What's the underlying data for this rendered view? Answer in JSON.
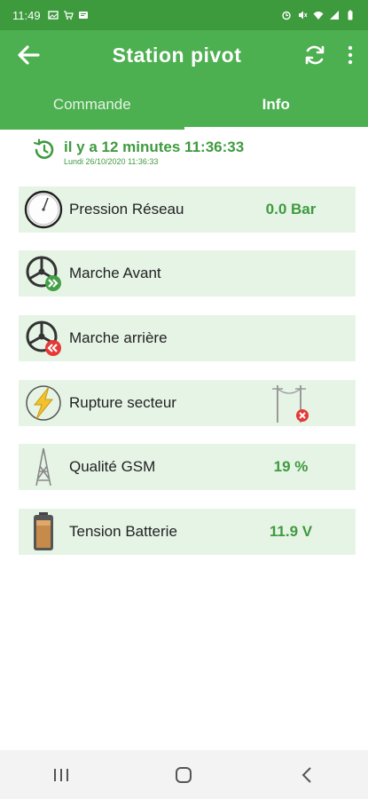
{
  "status_bar": {
    "time": "11:49"
  },
  "app_bar": {
    "title": "Station pivot"
  },
  "tabs": [
    {
      "label": "Commande",
      "active": false
    },
    {
      "label": "Info",
      "active": true
    }
  ],
  "last_update": {
    "relative": "il y a 12 minutes 11:36:33",
    "date": "Lundi 26/10/2020 11:36:33"
  },
  "rows": [
    {
      "icon": "pressure-gauge-icon",
      "label": "Pression Réseau",
      "value": "0.0 Bar"
    },
    {
      "icon": "forward-wheel-icon",
      "label": "Marche Avant",
      "value": ""
    },
    {
      "icon": "reverse-wheel-icon",
      "label": "Marche arrière",
      "value": ""
    },
    {
      "icon": "lightning-icon",
      "label": "Rupture secteur",
      "value": "",
      "status_icon": "power-line-fault-icon"
    },
    {
      "icon": "gsm-antenna-icon",
      "label": "Qualité GSM",
      "value": "19 %"
    },
    {
      "icon": "battery-icon",
      "label": "Tension Batterie",
      "value": "11.9 V"
    }
  ],
  "colors": {
    "primary": "#4caf50",
    "status_bar": "#3d9a3d",
    "accent_text": "#3f9a3f",
    "row_bg": "#e6f4e6"
  }
}
